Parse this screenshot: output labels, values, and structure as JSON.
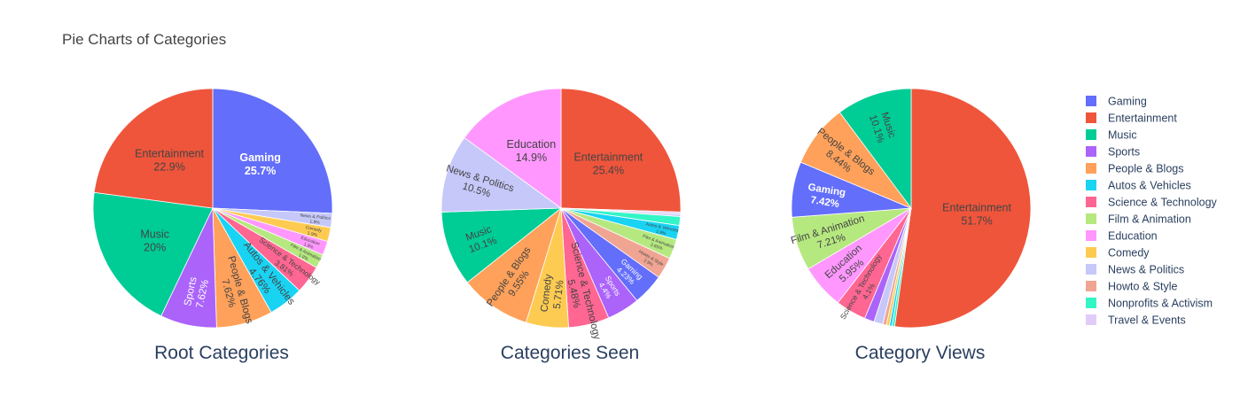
{
  "title": "Pie Charts of Categories",
  "legend": {
    "position": "right",
    "entries": [
      {
        "label": "Gaming",
        "color": "#636efa"
      },
      {
        "label": "Entertainment",
        "color": "#ef553b"
      },
      {
        "label": "Music",
        "color": "#00cc96"
      },
      {
        "label": "Sports",
        "color": "#ab63fa"
      },
      {
        "label": "People & Blogs",
        "color": "#ffa15a"
      },
      {
        "label": "Autos & Vehicles",
        "color": "#19d3f3"
      },
      {
        "label": "Science & Technology",
        "color": "#ff6692"
      },
      {
        "label": "Film & Animation",
        "color": "#b6e880"
      },
      {
        "label": "Education",
        "color": "#ff97ff"
      },
      {
        "label": "Comedy",
        "color": "#fecb52"
      },
      {
        "label": "News & Politics",
        "color": "#c6c8fa"
      },
      {
        "label": "Howto & Style",
        "color": "#f0a593"
      },
      {
        "label": "Nonprofits & Activism",
        "color": "#33f5c5"
      },
      {
        "label": "Travel & Events",
        "color": "#e1ccf8"
      }
    ]
  },
  "chart_data": [
    {
      "type": "pie",
      "title": "Root Categories",
      "slices": [
        {
          "label": "Gaming",
          "value": 25.7,
          "text": "25.7%"
        },
        {
          "label": "News & Politics",
          "value": 1.9,
          "text": "1.9%"
        },
        {
          "label": "Comedy",
          "value": 1.9,
          "text": "1.9%"
        },
        {
          "label": "Education",
          "value": 1.9,
          "text": "1.9%"
        },
        {
          "label": "Film & Animation",
          "value": 1.9,
          "text": "1.9%"
        },
        {
          "label": "Science & Technology",
          "value": 3.81,
          "text": "3.81%"
        },
        {
          "label": "Autos & Vehicles",
          "value": 4.76,
          "text": "4.76%"
        },
        {
          "label": "People & Blogs",
          "value": 7.62,
          "text": "7.62%"
        },
        {
          "label": "Sports",
          "value": 7.62,
          "text": "7.62%"
        },
        {
          "label": "Music",
          "value": 20,
          "text": "20%"
        },
        {
          "label": "Entertainment",
          "value": 22.9,
          "text": "22.9%"
        }
      ]
    },
    {
      "type": "pie",
      "title": "Categories Seen",
      "slices": [
        {
          "label": "Entertainment",
          "value": 25.4,
          "text": "25.4%"
        },
        {
          "label": "Travel & Events",
          "value": 0.3,
          "text": ""
        },
        {
          "label": "News & Politics",
          "value": 0.3,
          "text": ""
        },
        {
          "label": "Nonprofits & Activism",
          "value": 1.2,
          "text": ""
        },
        {
          "label": "Autos & Vehicles",
          "value": 1.9,
          "text": "1.9%"
        },
        {
          "label": "Film & Animation",
          "value": 2.65,
          "text": "2.65%"
        },
        {
          "label": "Howto & Style",
          "value": 2.9,
          "text": "2.9%"
        },
        {
          "label": "Gaming",
          "value": 4.23,
          "text": "4.23%"
        },
        {
          "label": "Sports",
          "value": 4.4,
          "text": "4.4%"
        },
        {
          "label": "Science & Technology",
          "value": 5.48,
          "text": "5.48%"
        },
        {
          "label": "Comedy",
          "value": 5.71,
          "text": "5.71%"
        },
        {
          "label": "People & Blogs",
          "value": 9.55,
          "text": "9.55%"
        },
        {
          "label": "Music",
          "value": 10.1,
          "text": "10.1%"
        },
        {
          "label": "News & Politics",
          "value": 10.5,
          "text": "10.5%"
        },
        {
          "label": "Education",
          "value": 14.9,
          "text": "14.9%"
        }
      ]
    },
    {
      "type": "pie",
      "title": "Category Views",
      "slices": [
        {
          "label": "Entertainment",
          "value": 51.7,
          "text": "51.7%"
        },
        {
          "label": "Nonprofits & Activism",
          "value": 0.35,
          "text": ""
        },
        {
          "label": "Autos & Vehicles",
          "value": 0.35,
          "text": ""
        },
        {
          "label": "Comedy",
          "value": 0.4,
          "text": ""
        },
        {
          "label": "Howto & Style",
          "value": 0.5,
          "text": ""
        },
        {
          "label": "News & Politics",
          "value": 1.2,
          "text": ""
        },
        {
          "label": "Sports",
          "value": 1.3,
          "text": ""
        },
        {
          "label": "Science & Technology",
          "value": 4.1,
          "text": "4.1%"
        },
        {
          "label": "Education",
          "value": 5.95,
          "text": "5.95%"
        },
        {
          "label": "Film & Animation",
          "value": 7.21,
          "text": "7.21%"
        },
        {
          "label": "Gaming",
          "value": 7.42,
          "text": "7.42%"
        },
        {
          "label": "People & Blogs",
          "value": 8.44,
          "text": "8.44%"
        },
        {
          "label": "Music",
          "value": 10.1,
          "text": "10.1%"
        }
      ]
    }
  ]
}
